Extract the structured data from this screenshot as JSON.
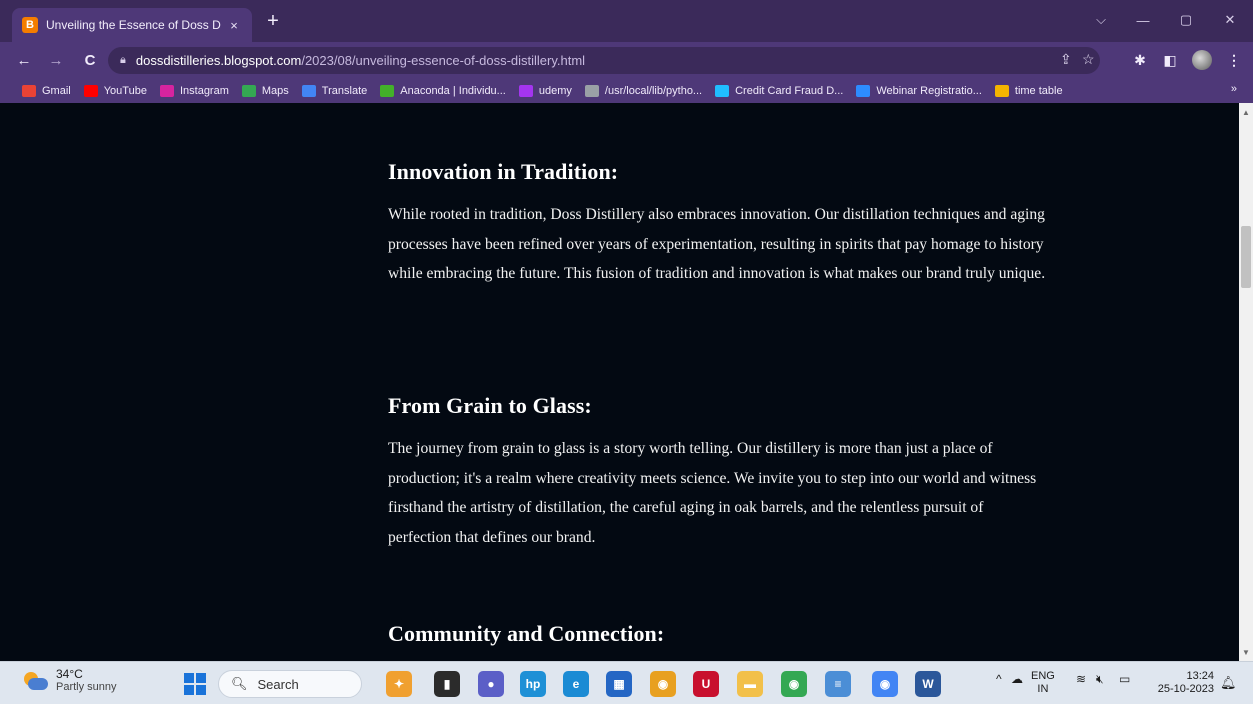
{
  "browser": {
    "tab_title": "Unveiling the Essence of Doss D",
    "tab_favicon": "B",
    "tab_close": "×",
    "new_tab": "+",
    "window_controls": {
      "dropdown": "⌵",
      "minimize": "—",
      "restore": "▢",
      "close": "✕"
    },
    "nav": {
      "back": "←",
      "forward": "→",
      "reload": "C"
    },
    "url_host": "dossdistilleries.blogspot.com",
    "url_path": "/2023/08/unveiling-essence-of-doss-distillery.html",
    "bookmarks": [
      {
        "label": "Gmail",
        "color": "#ea4335"
      },
      {
        "label": "YouTube",
        "color": "#ff0000"
      },
      {
        "label": "Instagram",
        "color": "#d6249f"
      },
      {
        "label": "Maps",
        "color": "#34a853"
      },
      {
        "label": "Translate",
        "color": "#4285f4"
      },
      {
        "label": "Anaconda | Individu...",
        "color": "#43b02a"
      },
      {
        "label": "udemy",
        "color": "#a435f0"
      },
      {
        "label": "/usr/local/lib/pytho...",
        "color": "#9aa0a6"
      },
      {
        "label": "Credit Card Fraud D...",
        "color": "#20beff"
      },
      {
        "label": "Webinar Registratio...",
        "color": "#2d8cff"
      },
      {
        "label": "time table",
        "color": "#f4b400"
      }
    ],
    "bookmarks_more": "»"
  },
  "article": {
    "sections": [
      {
        "heading": "Innovation in Tradition:",
        "body": "While rooted in tradition, Doss Distillery also embraces innovation. Our distillation techniques and aging processes have been refined over years of experimentation, resulting in spirits that pay homage to history while embracing the future. This fusion of tradition and innovation is what makes our brand truly unique."
      },
      {
        "heading": "From Grain to Glass:",
        "body": "The journey from grain to glass is a story worth telling. Our distillery is more than just a place of production; it's a realm where creativity meets science. We invite you to step into our world and witness firsthand the artistry of distillation, the careful aging in oak barrels, and the relentless pursuit of perfection that defines our brand."
      },
      {
        "heading": "Community and Connection:",
        "body": ""
      }
    ]
  },
  "taskbar": {
    "temperature": "34°C",
    "condition": "Partly sunny",
    "search_placeholder": "Search",
    "lang_top": "ENG",
    "lang_bottom": "IN",
    "time": "13:24",
    "date": "25-10-2023",
    "apps": [
      {
        "name": "widgets-app",
        "color": "#f0a030",
        "glyph": "✦"
      },
      {
        "name": "task-view",
        "color": "#2b2b2b",
        "glyph": "▮"
      },
      {
        "name": "chat-app",
        "color": "#5b5fc7",
        "glyph": "●"
      },
      {
        "name": "myhp-app",
        "color": "#1e90d6",
        "glyph": "hp"
      },
      {
        "name": "edge-browser",
        "color": "#1b8bd4",
        "glyph": "e"
      },
      {
        "name": "store-app",
        "color": "#2466c4",
        "glyph": "▦"
      },
      {
        "name": "chrome-app-1",
        "color": "#e8a020",
        "glyph": "◉"
      },
      {
        "name": "mcafee-app",
        "color": "#c8102e",
        "glyph": "U"
      },
      {
        "name": "file-explorer",
        "color": "#f2c04a",
        "glyph": "▬"
      },
      {
        "name": "chrome-app-2",
        "color": "#34a853",
        "glyph": "◉"
      },
      {
        "name": "notepad-app",
        "color": "#4b8ed6",
        "glyph": "≡"
      },
      {
        "name": "chrome-app-3",
        "color": "#4285f4",
        "glyph": "◉"
      },
      {
        "name": "word-app",
        "color": "#2b579a",
        "glyph": "W"
      }
    ]
  }
}
